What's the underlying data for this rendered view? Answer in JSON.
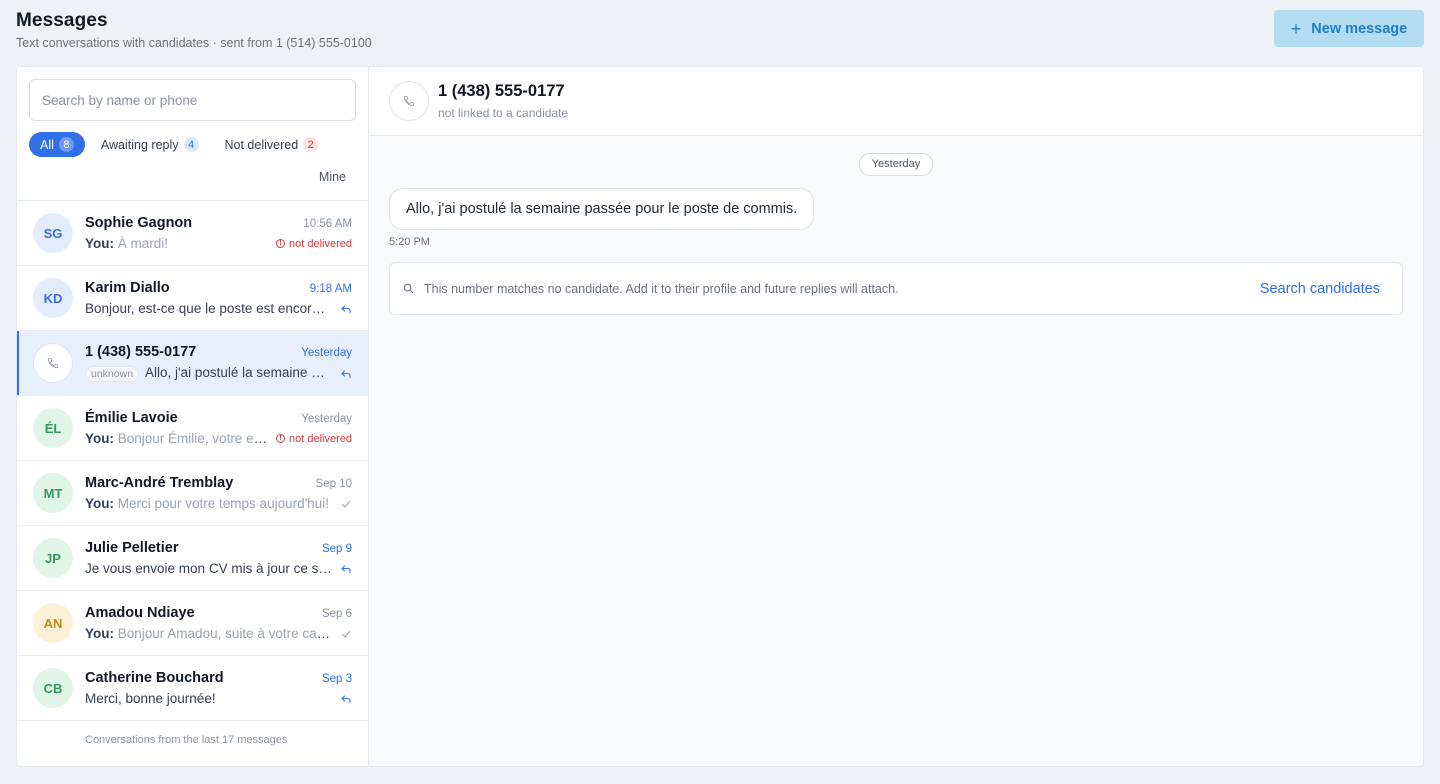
{
  "header": {
    "title": "Messages",
    "subtitle": "Text conversations with candidates · sent from 1 (514) 555-0100",
    "new_message_label": "New message",
    "new_message_plus": "+"
  },
  "search": {
    "placeholder": "Search by name or phone"
  },
  "filters": [
    {
      "label": "All",
      "count": "8"
    },
    {
      "label": "Awaiting reply",
      "count": "4"
    },
    {
      "label": "Not delivered",
      "count": "2"
    },
    {
      "label": "Mine"
    }
  ],
  "conversations": [
    {
      "initials": "SG",
      "name": "Sophie Gagnon",
      "time": "10:56 AM",
      "you": "You:",
      "preview": "À mardi!",
      "status": "not delivered"
    },
    {
      "initials": "KD",
      "name": "Karim Diallo",
      "time": "9:18 AM",
      "preview": "Bonjour, est-ce que le poste est encore disponible?"
    },
    {
      "name": "1 (438) 555-0177",
      "time": "Yesterday",
      "tag": "unknown",
      "preview": "Allo, j'ai postulé la semaine passée pour le poste de commis."
    },
    {
      "initials": "ÉL",
      "name": "Émilie Lavoie",
      "time": "Yesterday",
      "you": "You:",
      "preview": "Bonjour Émilie, votre entrevue est confirmée.",
      "status": "not delivered"
    },
    {
      "initials": "MT",
      "name": "Marc-André Tremblay",
      "time": "Sep 10",
      "you": "You:",
      "preview": "Merci pour votre temps aujourd'hui!"
    },
    {
      "initials": "JP",
      "name": "Julie Pelletier",
      "time": "Sep 9",
      "preview": "Je vous envoie mon CV mis à jour ce soir."
    },
    {
      "initials": "AN",
      "name": "Amadou Ndiaye",
      "time": "Sep 6",
      "you": "You:",
      "preview": "Bonjour Amadou, suite à votre candidature..."
    },
    {
      "initials": "CB",
      "name": "Catherine Bouchard",
      "time": "Sep 3",
      "preview": "Merci, bonne journée!"
    }
  ],
  "list_footer": "Conversations from the last 17 messages",
  "thread": {
    "title": "1 (438) 555-0177",
    "subtitle": "not linked to a candidate",
    "day_label": "Yesterday",
    "message": "Allo, j'ai postulé la semaine passée pour le poste de commis.",
    "message_time": "5:20 PM",
    "notice": "This number matches no candidate. Add it to their profile and future replies will attach.",
    "notice_action": "Search candidates"
  },
  "colors": {
    "accent": "#2f6fe8",
    "danger": "#d23a3a",
    "button_bg": "#b3dcf2"
  },
  "icons": {
    "phone": "phone-icon",
    "search": "search-icon",
    "reply": "reply-icon",
    "check": "check-icon",
    "alert": "alert-circle-icon",
    "plus": "plus-icon"
  }
}
